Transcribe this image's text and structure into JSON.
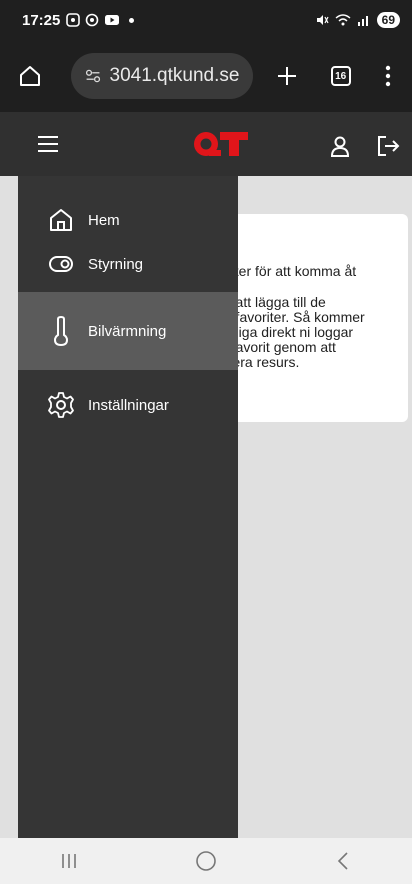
{
  "status": {
    "time": "17:25",
    "battery": "69"
  },
  "browser": {
    "url": "3041.qtkund.se",
    "tab_count": "16"
  },
  "app": {
    "logo_text": "QT",
    "brand_color": "#e0151a"
  },
  "drawer": {
    "items": [
      {
        "label": "Hem",
        "icon": "home-icon"
      },
      {
        "label": "Styrning",
        "icon": "toggle-icon"
      },
      {
        "label": "Bilvärmning",
        "icon": "thermometer-icon"
      },
      {
        "label": "Inställningar",
        "icon": "gear-icon"
      }
    ],
    "active_index": 2
  },
  "card": {
    "lines_1": [
      "aster för att komma åt"
    ],
    "lines_2": [
      "m att lägga till de",
      "m favoriter. Så kommer",
      "ngliga direkt ni loggar",
      "n favorit genom att",
      "rdera resurs."
    ]
  }
}
